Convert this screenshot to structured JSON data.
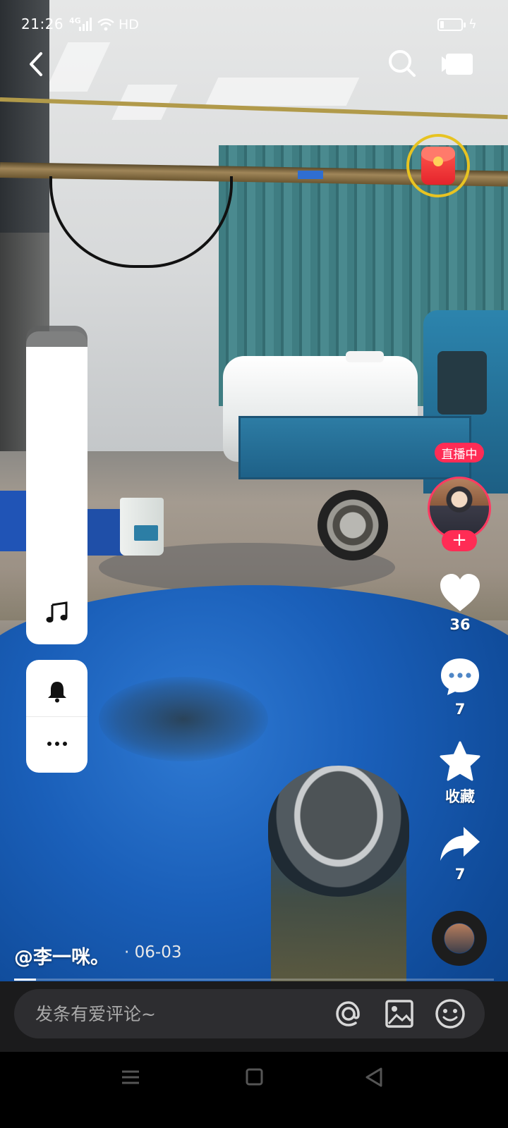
{
  "status_bar": {
    "time": "21:26",
    "network": "4G",
    "hd": "HD",
    "charge": "ϟ"
  },
  "right_actions": {
    "live_label": "直播中",
    "follow": "+",
    "likes": "36",
    "comments": "7",
    "favorite_label": "收藏",
    "shares": "7"
  },
  "author": {
    "name": "@李一咪。",
    "date": "· 06-03"
  },
  "video": {
    "progress": 0.045
  },
  "comment": {
    "placeholder": "发条有爱评论~"
  },
  "icons": {
    "back": "back-arrow-icon",
    "search": "search-icon",
    "camera": "camera-icon",
    "music": "music-note-icon",
    "bell": "bell-icon",
    "more": "more-dots-icon",
    "like": "heart-icon",
    "comment": "comment-bubble-icon",
    "favorite": "star-icon",
    "share": "share-arrow-icon",
    "mention": "at-icon",
    "image": "image-icon",
    "emoji": "emoji-icon"
  }
}
